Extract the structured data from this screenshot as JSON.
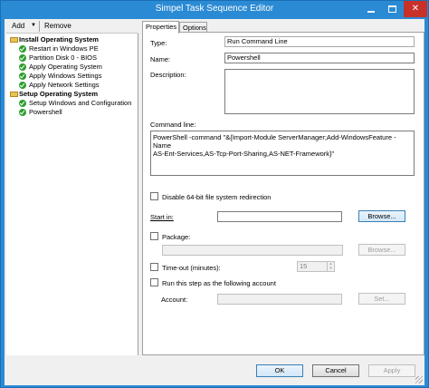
{
  "window": {
    "title": "Simpel Task Sequence Editor",
    "accent": "#2b8ad4",
    "close_color": "#c7312a"
  },
  "toolbar": {
    "add_label": "Add",
    "remove_label": "Remove"
  },
  "tree": {
    "groups": [
      {
        "label": "Install Operating System",
        "steps": [
          "Restart in Windows PE",
          "Partition Disk 0 - BIOS",
          "Apply Operating System",
          "Apply Windows Settings",
          "Apply Network Settings"
        ]
      },
      {
        "label": "Setup Operating System",
        "steps": [
          "Setup Windows and Configuration",
          "Powershell"
        ]
      }
    ]
  },
  "tabs": {
    "properties": "Properties",
    "options": "Options"
  },
  "properties": {
    "type_label": "Type:",
    "type_value": "Run Command Line",
    "name_label": "Name:",
    "name_value": "Powershell",
    "description_label": "Description:",
    "description_value": "",
    "command_line_label": "Command line:",
    "command_line_value": "PowerShell -command \"&{Import-Module ServerManager;Add-WindowsFeature -Name\nAS-Ent-Services,AS-Tcp-Port-Sharing,AS-NET-Framework}\"",
    "disable_64bit_label": "Disable 64-bit file system redirection",
    "start_in_label": "Start in:",
    "start_in_value": "",
    "browse_label": "Browse...",
    "package_label": "Package:",
    "package_value": "",
    "browse_package_label": "Browse...",
    "timeout_label": "Time-out (minutes):",
    "timeout_value": "15",
    "run_as_label": "Run this step as the following account",
    "account_label": "Account:",
    "account_value": "",
    "set_label": "Set..."
  },
  "footer": {
    "ok_label": "OK",
    "cancel_label": "Cancel",
    "apply_label": "Apply"
  }
}
